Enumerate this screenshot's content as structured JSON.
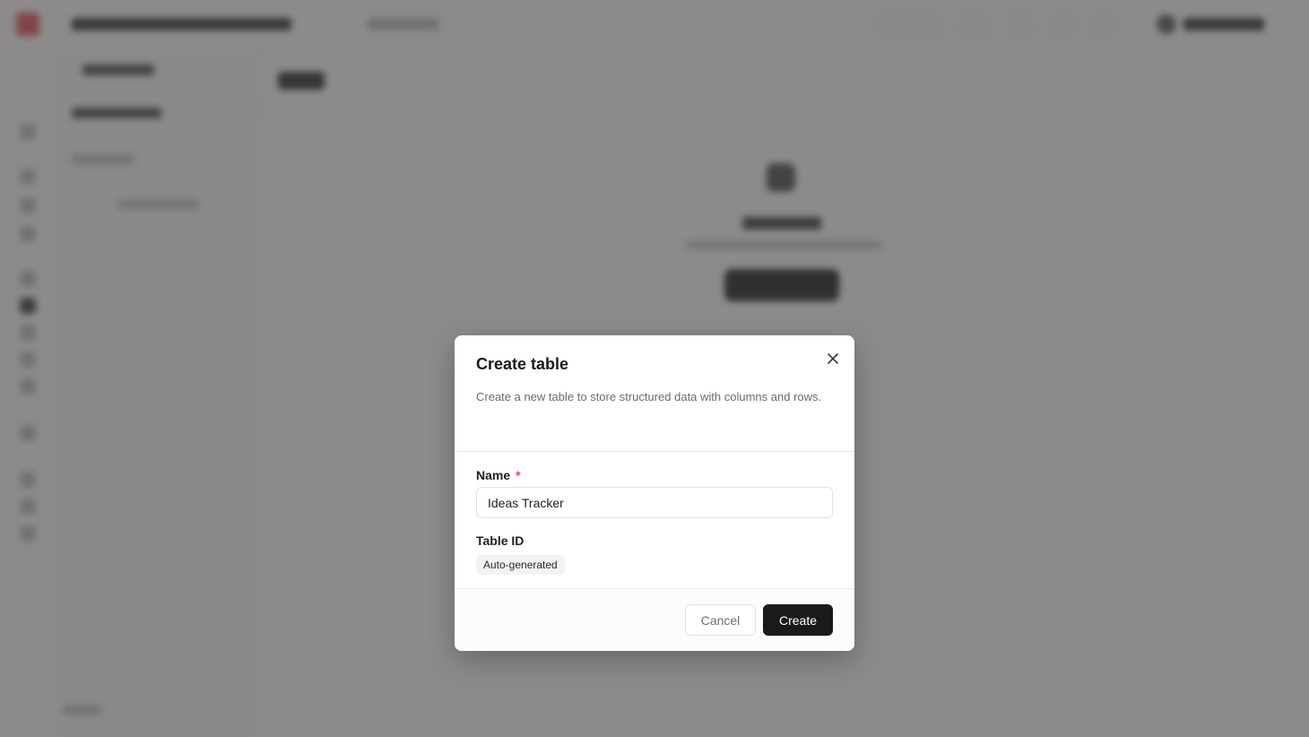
{
  "dialog": {
    "title": "Create table",
    "description": "Create a new table to store structured data with columns and rows.",
    "name_field": {
      "label": "Name",
      "required_marker": "*",
      "value": "Ideas Tracker"
    },
    "table_id_field": {
      "label": "Table ID",
      "value": "Auto-generated"
    },
    "buttons": {
      "cancel": "Cancel",
      "create": "Create"
    }
  },
  "colors": {
    "accent": "#e5484d",
    "primary_button": "#1a1a1a",
    "overlay": "#464242"
  },
  "icons": {
    "close": "close-icon"
  }
}
